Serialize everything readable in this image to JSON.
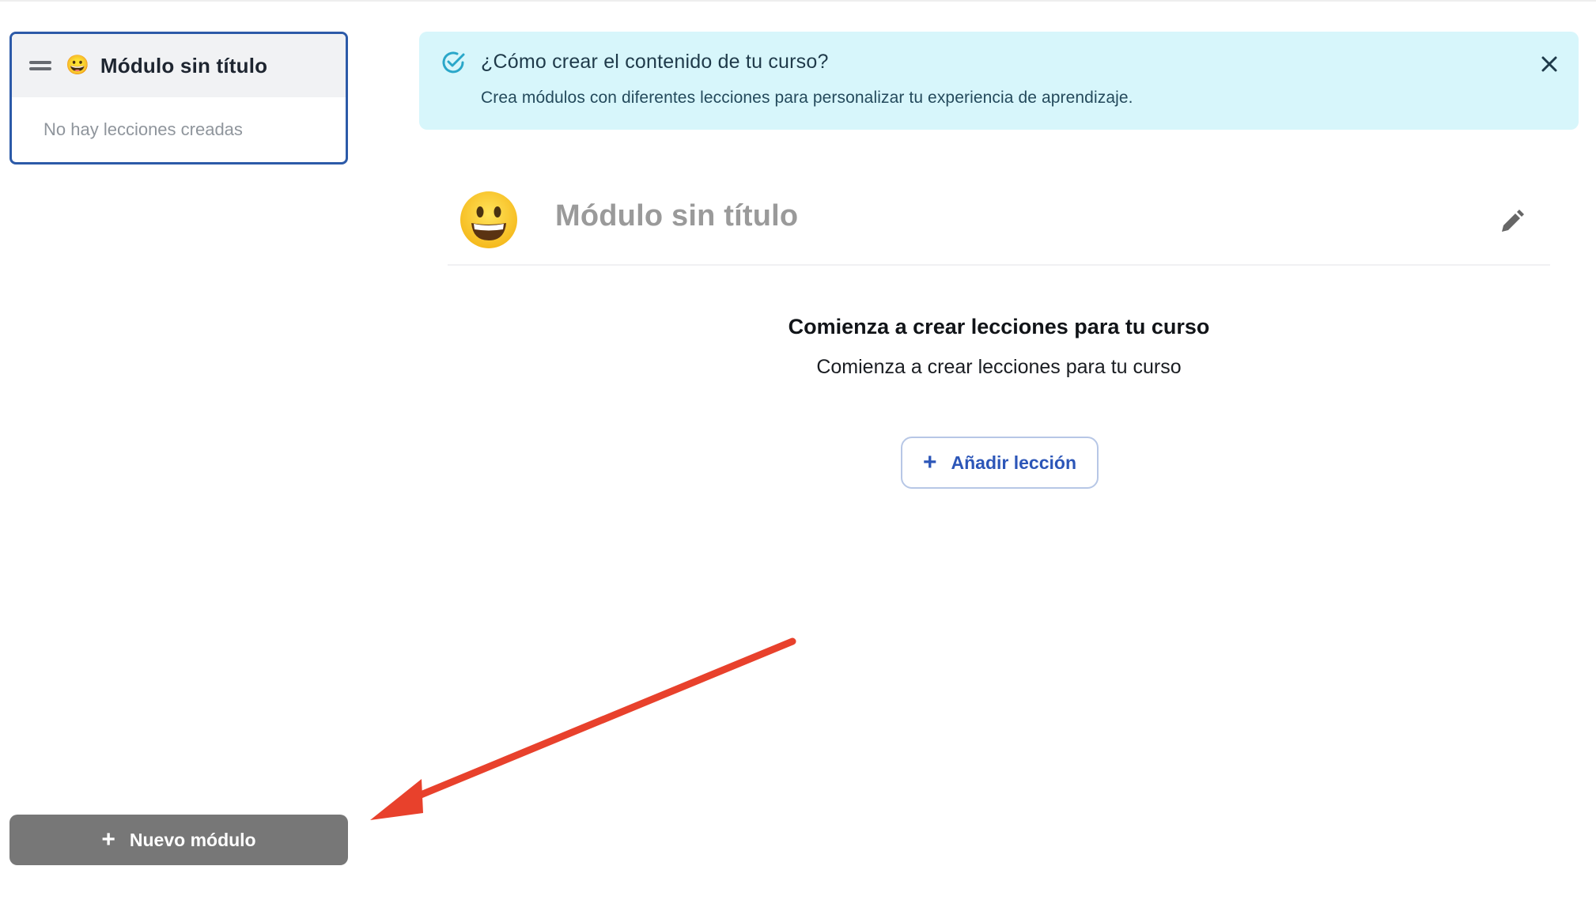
{
  "sidebar": {
    "module_card": {
      "emoji": "😀",
      "title": "Módulo sin título",
      "empty_text": "No hay lecciones creadas"
    },
    "new_module_button": {
      "icon": "plus-icon",
      "label": "Nuevo módulo"
    }
  },
  "info_banner": {
    "icon": "check-circle-icon",
    "title": "¿Cómo crear el contenido de tu curso?",
    "text": "Crea módulos con diferentes lecciones para personalizar tu experiencia de aprendizaje.",
    "close_icon": "close-icon"
  },
  "module_header": {
    "emoji": "grinning-face-icon",
    "title": "Módulo sin título",
    "edit_icon": "pencil-icon"
  },
  "empty_state": {
    "title": "Comienza a crear lecciones para tu curso",
    "subtitle": "Comienza a crear lecciones para tu curso",
    "add_lesson_button": {
      "icon": "plus-icon",
      "label": "Añadir lección"
    }
  },
  "annotation": {
    "type": "arrow",
    "color": "#e8412c"
  },
  "colors": {
    "accent_blue": "#2c5aa8",
    "banner_bg": "#d7f6fb",
    "button_gray": "#777777",
    "lesson_button_text": "#2c56b8"
  }
}
